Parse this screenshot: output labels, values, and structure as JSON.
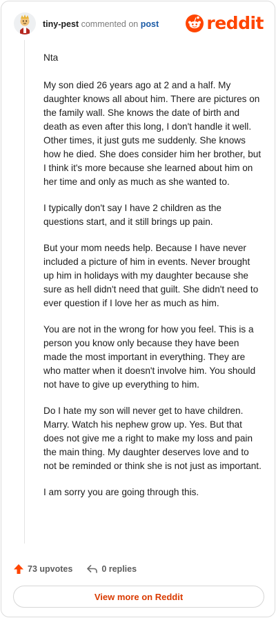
{
  "comment": {
    "author": "tiny-pest",
    "verb": "commented on",
    "target": "post",
    "paragraphs": [
      "Nta",
      "My son died 26 years ago at 2 and a half. My daughter knows all about him. There are pictures on the family wall. She knows the date of birth and death as even after this long, I don't handle it well. Other times, it just guts me suddenly. She knows how he died. She does consider him her brother, but I think it's more because she learned about him on her time and only as much as she wanted to.",
      "I typically don't say I have 2 children as the questions start, and it still brings up pain.",
      "But your mom needs help. Because I have never included a picture of him in events. Never brought up him in holidays with my daughter because she sure as hell didn't need that guilt. She didn't need to ever question if I love her as much as him.",
      "You are not in the wrong for how you feel. This is a person you know only because they have been made the most important in everything. They are who matter when it doesn't involve him. You should not have to give up everything to him.",
      "Do I hate my son will never get to have children. Marry. Watch his nephew grow up. Yes. But that does not give me a right to make my loss and pain the main thing. My daughter deserves love and to not be reminded or think she is not just as important.",
      "I am sorry you are going through this."
    ],
    "upvotes_label": "73 upvotes",
    "replies_label": "0 replies"
  },
  "brand": {
    "wordmark": "reddit",
    "color": "#ff4500"
  },
  "footer": {
    "view_more_label": "View more on Reddit"
  },
  "icons": {
    "upvote": "upvote-arrow-icon",
    "reply": "reply-arrow-icon",
    "logo": "reddit-snoo-icon",
    "avatar": "user-avatar"
  },
  "colors": {
    "accent": "#ff4500",
    "link": "#1a5aa6",
    "button_text": "#d93a00"
  }
}
